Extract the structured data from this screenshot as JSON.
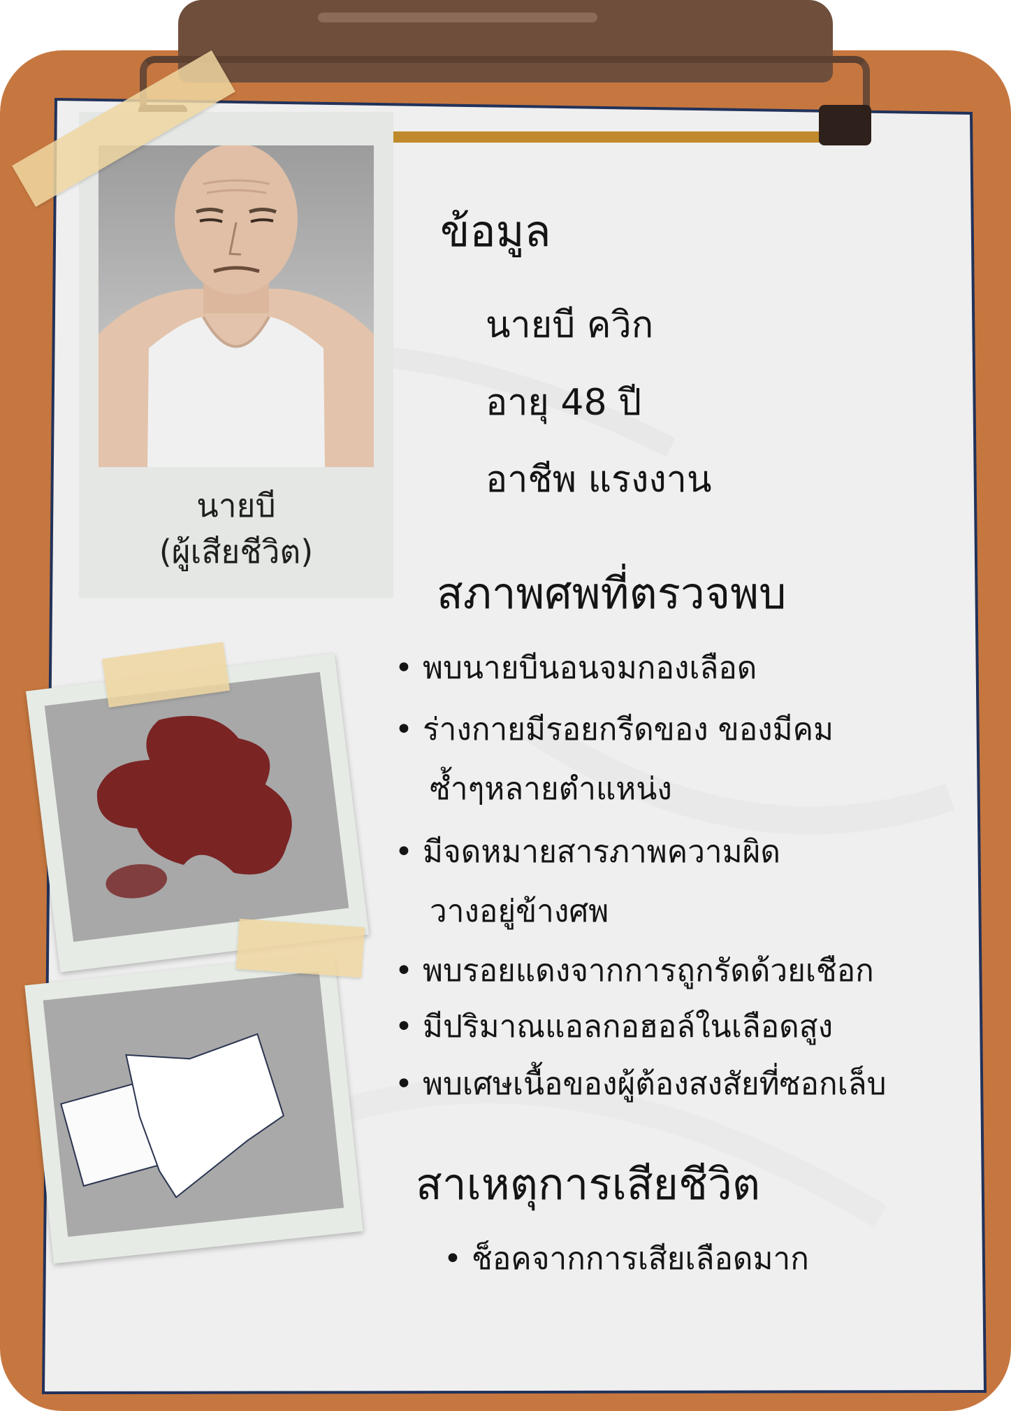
{
  "victim": {
    "caption_name": "นายบี",
    "caption_status": "(ผู้เสียชีวิต)"
  },
  "info": {
    "heading": "ข้อมูล",
    "name": "นายบี ควิก",
    "age": "อายุ 48 ปี",
    "occupation": "อาชีพ แรงงาน"
  },
  "findings": {
    "heading": "สภาพศพที่ตรวจพบ",
    "bullet": "•",
    "items": [
      "พบนายบีนอนจมกองเลือด",
      "ร่างกายมีรอยกรีดของ ของมีคม",
      "ซ้ำๆหลายตำแหน่ง",
      "มีจดหมายสารภาพความผิด",
      "วางอยู่ข้างศพ",
      "พบรอยแดงจากการถูกรัดด้วยเชือก",
      "มีปริมาณแอลกอฮอล์ในเลือดสูง",
      "พบเศษเนื้อของผู้ต้องสงสัยที่ซอกเล็บ"
    ]
  },
  "cause": {
    "heading": "สาเหตุการเสียชีวิต",
    "bullet": "•",
    "text": "ช็อคจากการเสียเลือดมาก"
  },
  "colors": {
    "board": "#c6773f",
    "clip": "#6f4e3b",
    "paper": "#efefef",
    "paper_border": "#22325a",
    "blood": "#7a2424",
    "tape": "#efd6a1"
  },
  "icons": {
    "clipboard": "clipboard-icon",
    "portrait": "bald-man-portrait",
    "blood_photo": "blood-stain-photo",
    "letter_photo": "crumpled-letter-photo"
  }
}
